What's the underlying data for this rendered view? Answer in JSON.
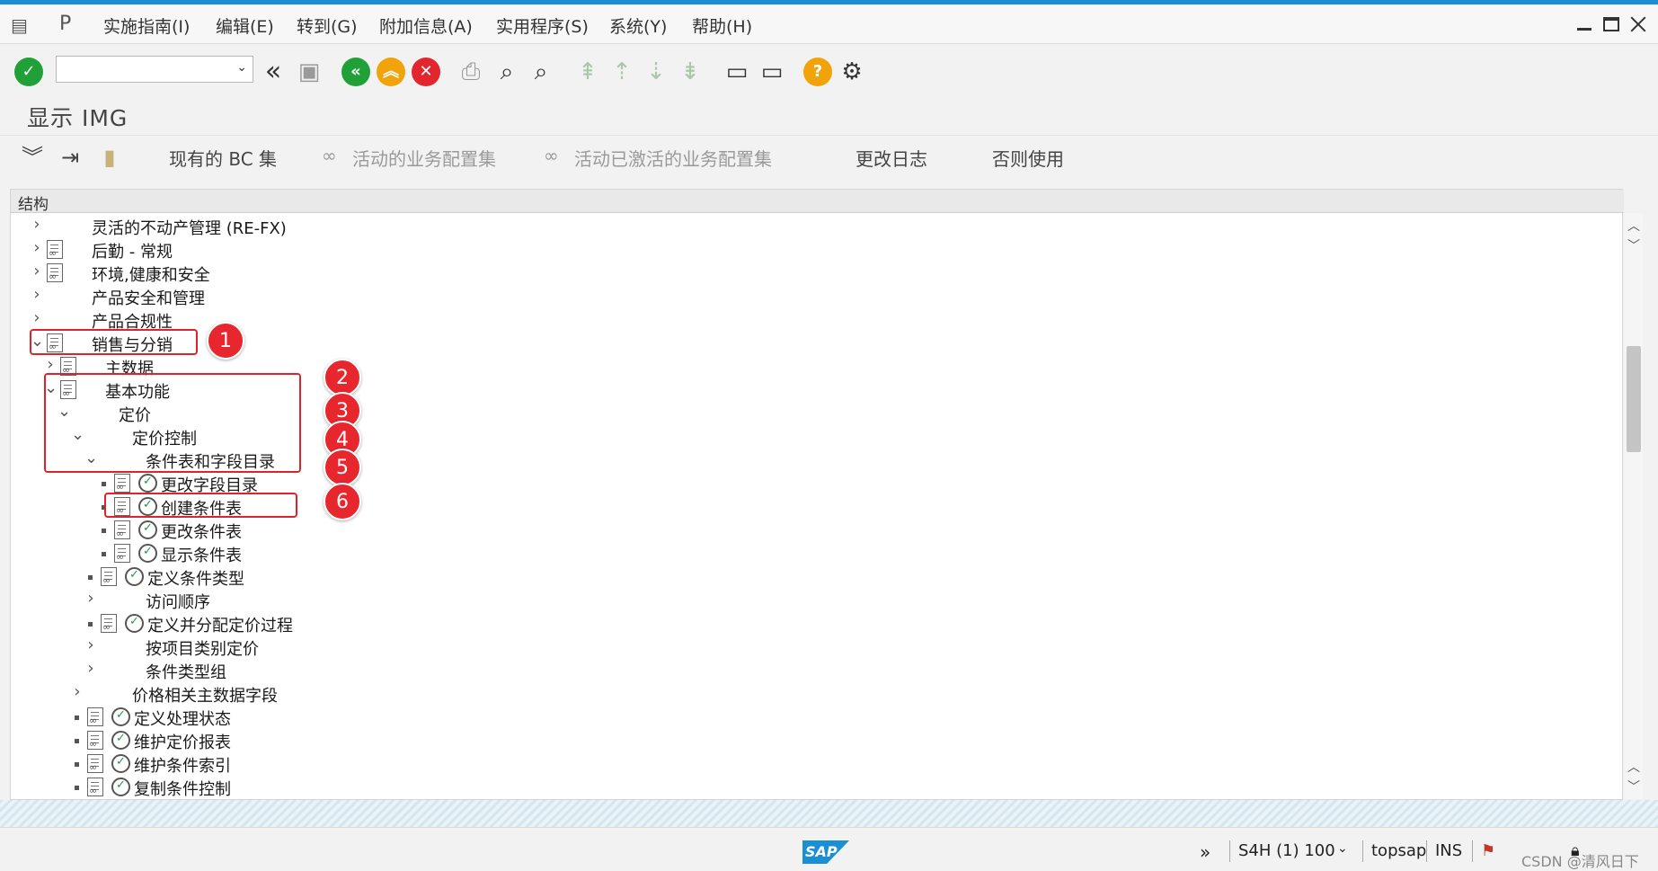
{
  "menu": {
    "items": [
      "实施指南(I)",
      "编辑(E)",
      "转到(G)",
      "附加信息(A)",
      "实用程序(S)",
      "系统(Y)",
      "帮助(H)"
    ]
  },
  "toolbar": {
    "command_field_value": "",
    "icons": [
      "enter-icon",
      "back-double-icon",
      "save-icon",
      "back-icon",
      "exit-icon",
      "cancel-icon",
      "print-icon",
      "find-icon",
      "find-next-icon",
      "first-page-icon",
      "prev-page-icon",
      "next-page-icon",
      "last-page-icon",
      "new-session-icon",
      "shortcut-icon",
      "help-icon",
      "settings-icon"
    ]
  },
  "page": {
    "title": "显示 IMG"
  },
  "app_toolbar": {
    "existing_bc_sets": "现有的 BC 集",
    "active_config_sets": "活动的业务配置集",
    "activated_config_sets": "活动已激活的业务配置集",
    "change_log": "更改日志",
    "where_used": "否则使用"
  },
  "tree": {
    "header": "结构",
    "rows": [
      {
        "label": "灵活的不动产管理 (RE-FX)",
        "expander": "collapsed",
        "doc": false,
        "exec": false,
        "bullet": false,
        "level": 0
      },
      {
        "label": "后勤 - 常规",
        "expander": "collapsed",
        "doc": true,
        "exec": false,
        "bullet": false,
        "level": 0
      },
      {
        "label": "环境,健康和安全",
        "expander": "collapsed",
        "doc": true,
        "exec": false,
        "bullet": false,
        "level": 0
      },
      {
        "label": "产品安全和管理",
        "expander": "collapsed",
        "doc": false,
        "exec": false,
        "bullet": false,
        "level": 0
      },
      {
        "label": "产品合规性",
        "expander": "collapsed",
        "doc": false,
        "exec": false,
        "bullet": false,
        "level": 0
      },
      {
        "label": "销售与分销",
        "expander": "expanded",
        "doc": true,
        "exec": false,
        "bullet": false,
        "level": 0
      },
      {
        "label": "主数据",
        "expander": "collapsed",
        "doc": true,
        "exec": false,
        "bullet": false,
        "level": 1
      },
      {
        "label": "基本功能",
        "expander": "expanded",
        "doc": true,
        "exec": false,
        "bullet": false,
        "level": 1
      },
      {
        "label": "定价",
        "expander": "expanded",
        "doc": false,
        "exec": false,
        "bullet": false,
        "level": 2
      },
      {
        "label": "定价控制",
        "expander": "expanded",
        "doc": false,
        "exec": false,
        "bullet": false,
        "level": 3
      },
      {
        "label": "条件表和字段目录",
        "expander": "expanded",
        "doc": false,
        "exec": false,
        "bullet": false,
        "level": 4
      },
      {
        "label": "更改字段目录",
        "expander": "none",
        "doc": true,
        "exec": true,
        "bullet": true,
        "level": 5
      },
      {
        "label": "创建条件表",
        "expander": "none",
        "doc": true,
        "exec": true,
        "bullet": true,
        "level": 5
      },
      {
        "label": "更改条件表",
        "expander": "none",
        "doc": true,
        "exec": true,
        "bullet": true,
        "level": 5
      },
      {
        "label": "显示条件表",
        "expander": "none",
        "doc": true,
        "exec": true,
        "bullet": true,
        "level": 5
      },
      {
        "label": "定义条件类型",
        "expander": "none",
        "doc": true,
        "exec": true,
        "bullet": true,
        "level": 4
      },
      {
        "label": "访问顺序",
        "expander": "collapsed",
        "doc": false,
        "exec": false,
        "bullet": false,
        "level": 4
      },
      {
        "label": "定义并分配定价过程",
        "expander": "none",
        "doc": true,
        "exec": true,
        "bullet": true,
        "level": 4
      },
      {
        "label": "按项目类别定价",
        "expander": "collapsed",
        "doc": false,
        "exec": false,
        "bullet": false,
        "level": 4
      },
      {
        "label": "条件类型组",
        "expander": "collapsed",
        "doc": false,
        "exec": false,
        "bullet": false,
        "level": 4
      },
      {
        "label": "价格相关主数据字段",
        "expander": "collapsed",
        "doc": false,
        "exec": false,
        "bullet": false,
        "level": 3
      },
      {
        "label": "定义处理状态",
        "expander": "none",
        "doc": true,
        "exec": true,
        "bullet": true,
        "level": 3
      },
      {
        "label": "维护定价报表",
        "expander": "none",
        "doc": true,
        "exec": true,
        "bullet": true,
        "level": 3
      },
      {
        "label": "维护条件索引",
        "expander": "none",
        "doc": true,
        "exec": true,
        "bullet": true,
        "level": 3
      },
      {
        "label": "复制条件控制",
        "expander": "none",
        "doc": true,
        "exec": true,
        "bullet": true,
        "level": 3
      }
    ]
  },
  "annotations": [
    "1",
    "2",
    "3",
    "4",
    "5",
    "6"
  ],
  "status": {
    "system": "S4H (1) 100",
    "server": "topsap",
    "mode": "INS",
    "watermark": "CSDN @清风日下"
  },
  "colors": {
    "accent": "#1b8fd6",
    "highlight": "#e0232b",
    "ok_green": "#21a038"
  }
}
